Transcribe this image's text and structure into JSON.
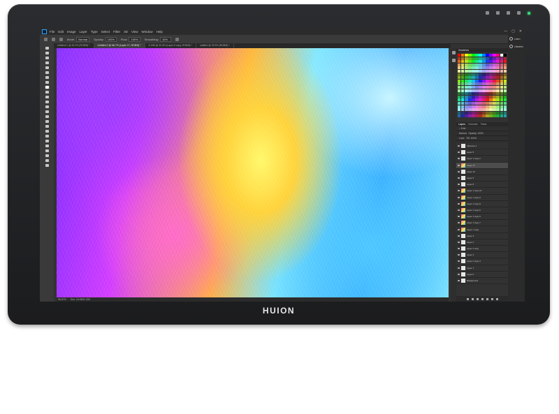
{
  "device": {
    "brand": "HUION"
  },
  "menu": {
    "items": [
      "File",
      "Edit",
      "Image",
      "Layer",
      "Type",
      "Select",
      "Filter",
      "3D",
      "View",
      "Window",
      "Help"
    ],
    "window_controls": [
      "—",
      "▢",
      "✕"
    ]
  },
  "options_bar": {
    "mode_label": "Mode:",
    "mode_value": "Normal",
    "opacity_label": "Opacity:",
    "opacity_value": "100%",
    "flow_label": "Flow:",
    "flow_value": "100%",
    "smoothing_label": "Smoothing:",
    "smoothing_value": "10%"
  },
  "tabs": [
    {
      "label": "Untitled-1 @ 33.3% (RGB/8) *"
    },
    {
      "label": "Untitled-2 @ 66.7% (Layer 17, RGB/8) *"
    },
    {
      "label": "5-038 @ 33.3% (Layer 6 copy, RGB/8) *"
    },
    {
      "label": "untitled @ 33.3% (RGB/8) *"
    }
  ],
  "status": {
    "zoom": "66.67%",
    "doc": "Doc: 24.9M/1.15G"
  },
  "panels": {
    "swatches_tab": "Swatches",
    "layers_tabs": [
      "Layers",
      "Channels",
      "Paths"
    ],
    "blend_mode": "Normal",
    "opacity_label": "Opacity: 100%",
    "lock_label": "Lock:",
    "fill_label": "Fill: 100%",
    "layers": [
      {
        "name": "Vibrance 1",
        "thumb": "white",
        "selected": false
      },
      {
        "name": "Layer 5",
        "thumb": "white",
        "selected": false
      },
      {
        "name": "Layer 1 copy 2",
        "thumb": "white",
        "selected": false
      },
      {
        "name": "Layer 17",
        "thumb": "color",
        "selected": true
      },
      {
        "name": "Layer 13",
        "thumb": "white",
        "selected": false
      },
      {
        "name": "Layer 9",
        "thumb": "white",
        "selected": false
      },
      {
        "name": "Layer 8",
        "thumb": "white",
        "selected": false
      },
      {
        "name": "Layer 1 copy 10",
        "thumb": "color",
        "selected": false
      },
      {
        "name": "Layer 1 copy 9",
        "thumb": "color",
        "selected": false
      },
      {
        "name": "Layer 1 copy 8",
        "thumb": "color",
        "selected": false
      },
      {
        "name": "Layer 1 copy 6",
        "thumb": "color",
        "selected": false
      },
      {
        "name": "Layer 1 copy 5",
        "thumb": "color",
        "selected": false
      },
      {
        "name": "Layer 1 copy 7",
        "thumb": "color",
        "selected": false
      },
      {
        "name": "Layer 1 copy",
        "thumb": "color",
        "selected": false
      },
      {
        "name": "Layer 3",
        "thumb": "white",
        "selected": false
      },
      {
        "name": "Layer 2",
        "thumb": "white",
        "selected": false
      },
      {
        "name": "Layer 2 copy",
        "thumb": "white",
        "selected": false
      },
      {
        "name": "Layer 4",
        "thumb": "white",
        "selected": false
      },
      {
        "name": "Layer 2 copy 3",
        "thumb": "white",
        "selected": false
      },
      {
        "name": "Layer 7",
        "thumb": "white",
        "selected": false
      },
      {
        "name": "Layer 6",
        "thumb": "white",
        "selected": false
      },
      {
        "name": "Background",
        "thumb": "white",
        "selected": false
      }
    ],
    "right_items": [
      {
        "label": "Learn",
        "icon": "lightbulb-icon"
      },
      {
        "label": "Libraries",
        "icon": "libraries-icon"
      }
    ]
  },
  "colors": {
    "bezel": "#1f2022",
    "ui_dark": "#323232",
    "swatch_palette": [
      "#ff0000",
      "#ff7f00",
      "#ffff00",
      "#7fff00",
      "#00ff00",
      "#00ff7f",
      "#00ffff",
      "#007fff",
      "#0000ff",
      "#7f00ff",
      "#ff00ff",
      "#ff007f",
      "#ffffff",
      "#000000"
    ]
  }
}
